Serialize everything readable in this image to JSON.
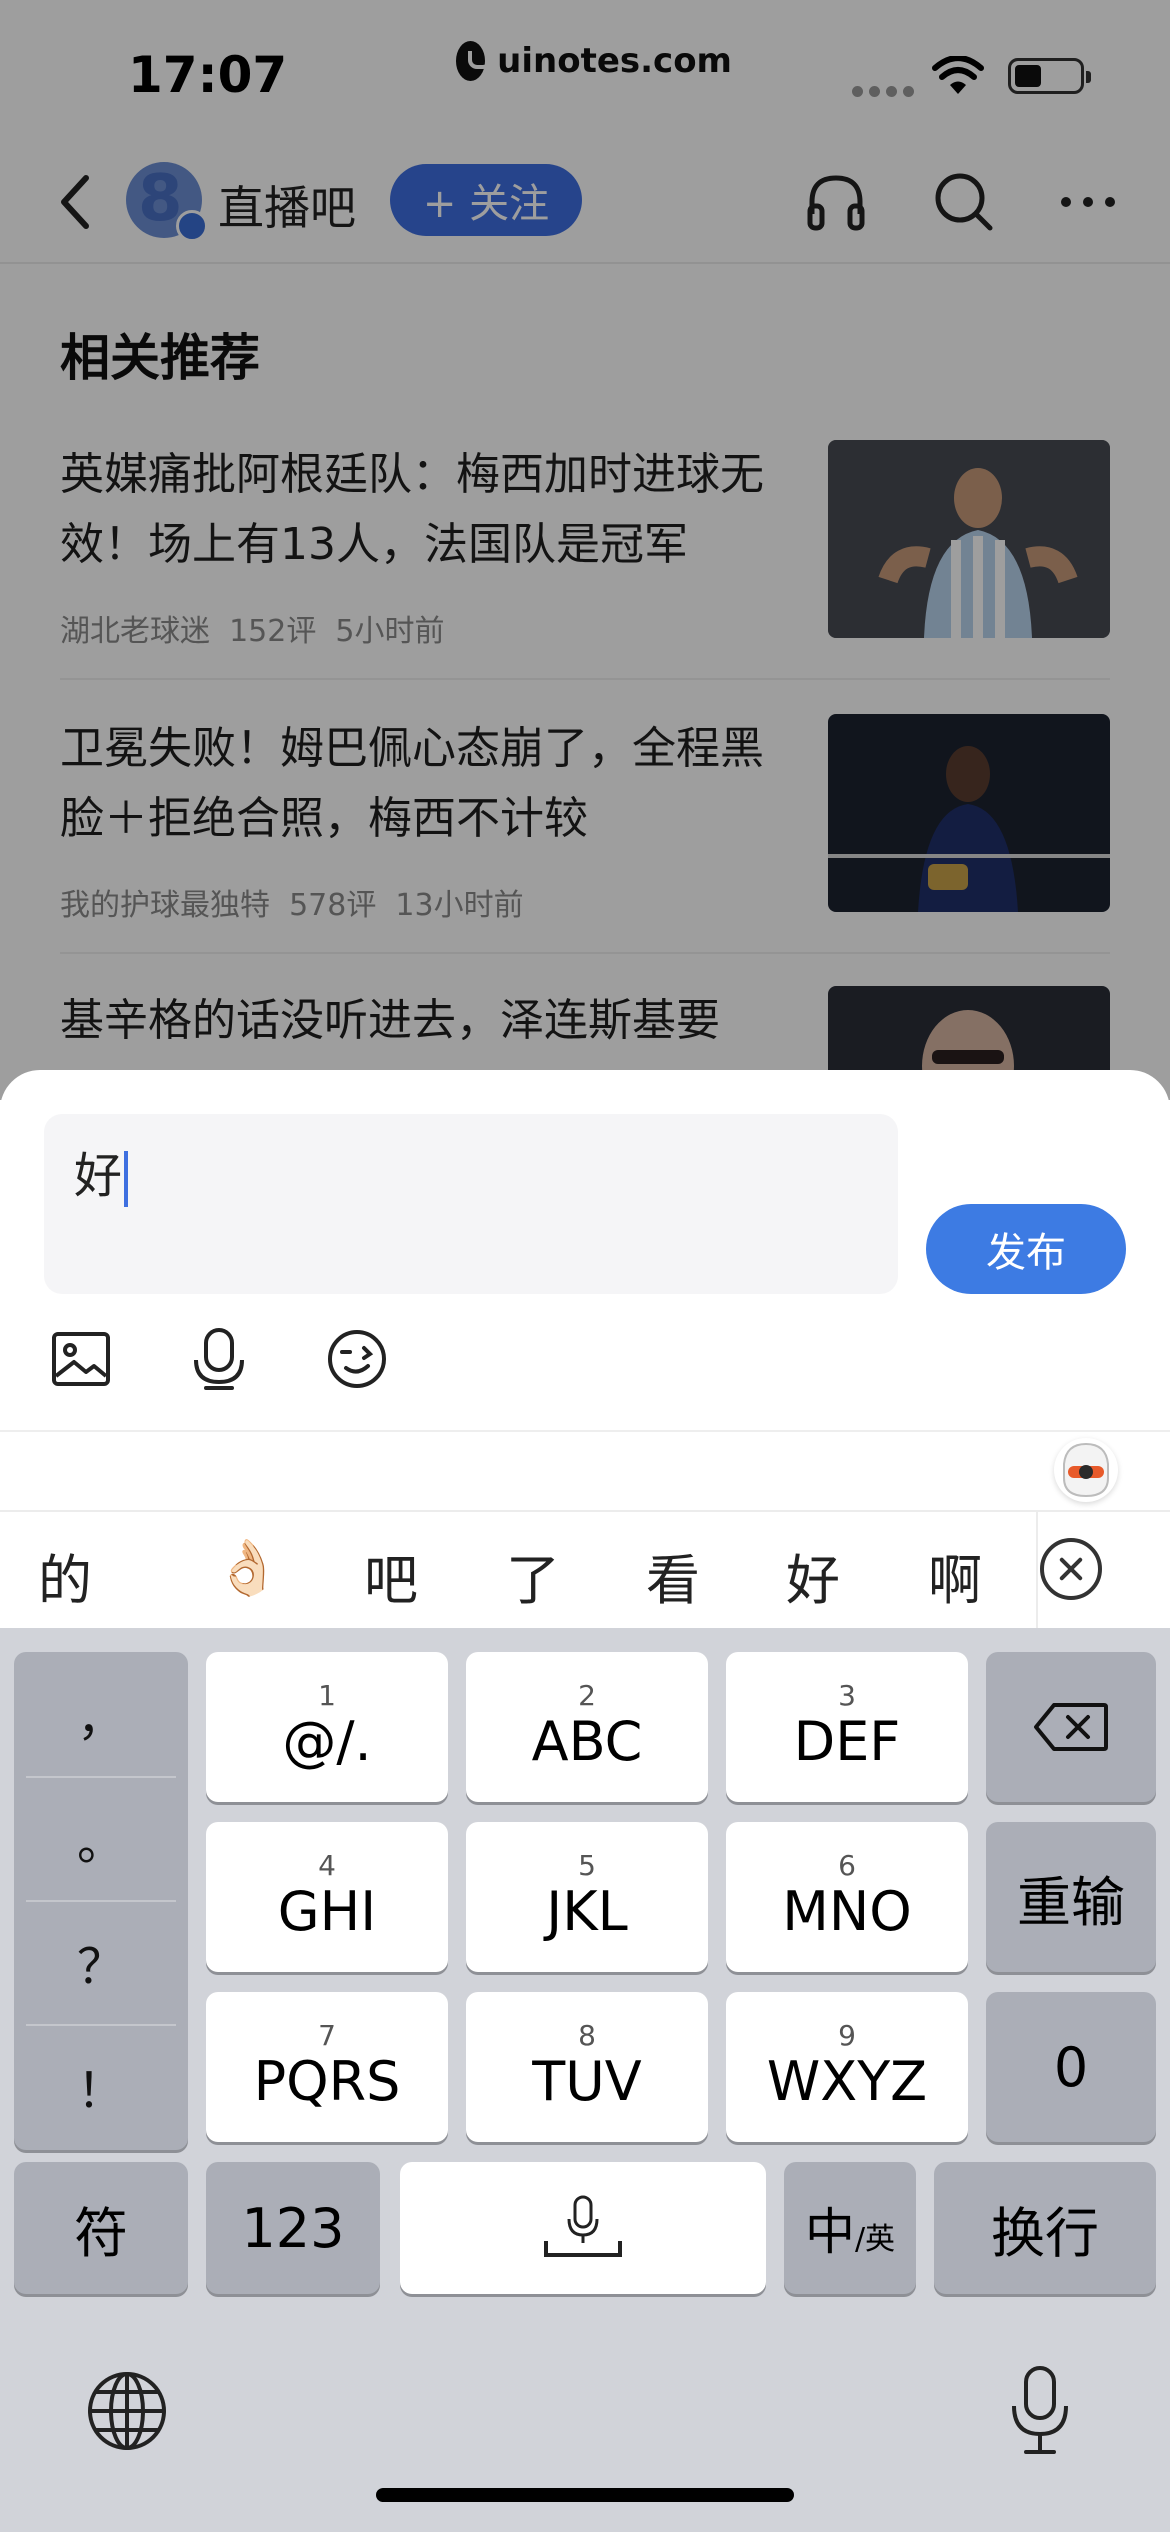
{
  "status_bar": {
    "time": "17:07",
    "watermark": "uinotes.com"
  },
  "nav": {
    "forum_name": "直播吧",
    "follow_label": "+ 关注"
  },
  "recommend": {
    "title": "相关推荐",
    "articles": [
      {
        "title": "英媒痛批阿根廷队：梅西加时进球无效！场上有13人，法国队是冠军",
        "author": "湖北老球迷",
        "comments": "152评",
        "time": "5小时前"
      },
      {
        "title": "卫冕失败！姆巴佩心态崩了，全程黑脸＋拒绝合照，梅西不计较",
        "author": "我的护球最独特",
        "comments": "578评",
        "time": "13小时前"
      },
      {
        "title": "基辛格的话没听进去，泽连斯基要",
        "author": "",
        "comments": "",
        "time": ""
      }
    ]
  },
  "comment": {
    "input_value": "好",
    "publish_label": "发布"
  },
  "keyboard": {
    "suggestions": [
      "的",
      "👌🏻",
      "吧",
      "了",
      "看",
      "好",
      "啊"
    ],
    "punctuation": [
      "，",
      "。",
      "？",
      "！"
    ],
    "keys": [
      {
        "num": "1",
        "letters": "@/."
      },
      {
        "num": "2",
        "letters": "ABC"
      },
      {
        "num": "3",
        "letters": "DEF"
      },
      {
        "num": "4",
        "letters": "GHI"
      },
      {
        "num": "5",
        "letters": "JKL"
      },
      {
        "num": "6",
        "letters": "MNO"
      },
      {
        "num": "7",
        "letters": "PQRS"
      },
      {
        "num": "8",
        "letters": "TUV"
      },
      {
        "num": "9",
        "letters": "WXYZ"
      }
    ],
    "reinput_label": "重输",
    "zero_label": "0",
    "symbol_label": "符",
    "numbers_label": "123",
    "lang_main": "中",
    "lang_sub": "/英",
    "return_label": "换行"
  },
  "icons": {
    "back": "chevron-left-icon",
    "headphones": "headphones-icon",
    "search": "search-icon",
    "more": "more-icon",
    "image": "image-icon",
    "voice": "microphone-icon",
    "emoji": "emoji-icon",
    "delete": "backspace-icon",
    "globe": "globe-icon",
    "dictation": "microphone-icon"
  },
  "colors": {
    "accent": "#3d7be3",
    "follow_button": "#3e6fe0",
    "keyboard_bg": "#d1d3d9",
    "key_gray": "#abaeb7"
  }
}
